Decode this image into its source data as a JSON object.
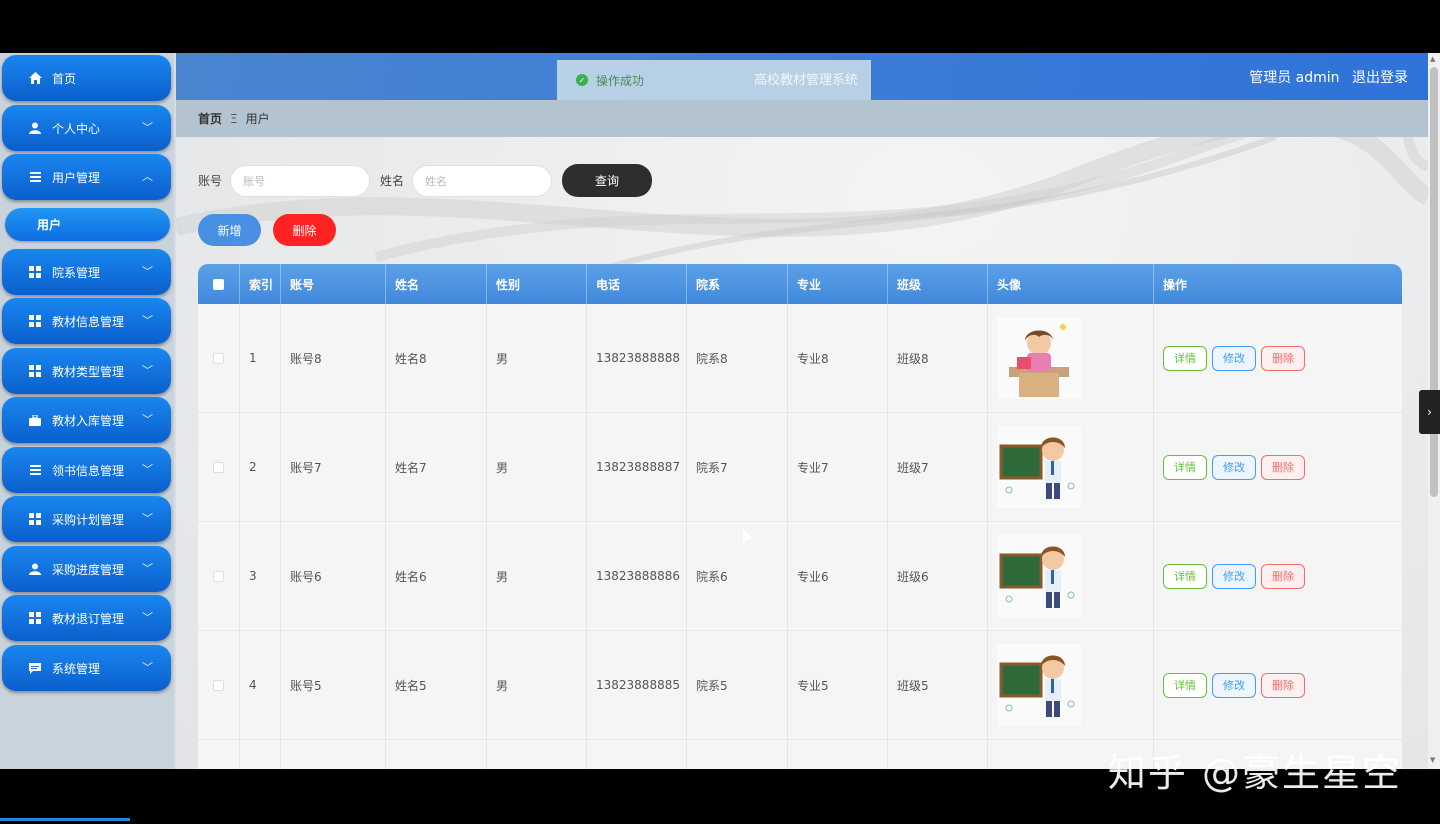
{
  "sidebar": {
    "items": [
      {
        "label": "首页",
        "icon": "home-icon",
        "has_chevron": false
      },
      {
        "label": "个人中心",
        "icon": "user-icon",
        "has_chevron": true
      },
      {
        "label": "用户管理",
        "icon": "list-icon",
        "has_chevron": true,
        "expanded": true
      },
      {
        "label": "院系管理",
        "icon": "grid-icon",
        "has_chevron": true
      },
      {
        "label": "教材信息管理",
        "icon": "grid-icon",
        "has_chevron": true
      },
      {
        "label": "教材类型管理",
        "icon": "grid-icon",
        "has_chevron": true
      },
      {
        "label": "教材入库管理",
        "icon": "briefcase-icon",
        "has_chevron": true
      },
      {
        "label": "领书信息管理",
        "icon": "list-icon",
        "has_chevron": true
      },
      {
        "label": "采购计划管理",
        "icon": "grid-icon",
        "has_chevron": true
      },
      {
        "label": "采购进度管理",
        "icon": "user-icon",
        "has_chevron": true
      },
      {
        "label": "教材退订管理",
        "icon": "grid-icon",
        "has_chevron": true
      },
      {
        "label": "系统管理",
        "icon": "chat-icon",
        "has_chevron": true
      }
    ],
    "sub_item": "用户"
  },
  "header": {
    "toast_message": "操作成功",
    "system_title": "高校教材管理系统",
    "user_label": "管理员 admin",
    "logout": "退出登录"
  },
  "breadcrumb": {
    "home": "首页",
    "separator": "Ξ",
    "current": "用户"
  },
  "search": {
    "account_label": "账号",
    "account_placeholder": "账号",
    "name_label": "姓名",
    "name_placeholder": "姓名",
    "query_button": "查询"
  },
  "actions": {
    "add": "新增",
    "delete": "删除"
  },
  "table": {
    "headers": [
      "索引",
      "账号",
      "姓名",
      "性别",
      "电话",
      "院系",
      "专业",
      "班级",
      "头像",
      "操作"
    ],
    "op_labels": {
      "detail": "详情",
      "edit": "修改",
      "delete": "删除"
    },
    "rows": [
      {
        "index": "1",
        "account": "账号8",
        "name": "姓名8",
        "gender": "男",
        "phone": "13823888888",
        "dept": "院系8",
        "major": "专业8",
        "class": "班级8",
        "avatar": "teacher-reading"
      },
      {
        "index": "2",
        "account": "账号7",
        "name": "姓名7",
        "gender": "男",
        "phone": "13823888887",
        "dept": "院系7",
        "major": "专业7",
        "class": "班级7",
        "avatar": "teacher-blackboard"
      },
      {
        "index": "3",
        "account": "账号6",
        "name": "姓名6",
        "gender": "男",
        "phone": "13823888886",
        "dept": "院系6",
        "major": "专业6",
        "class": "班级6",
        "avatar": "teacher-blackboard"
      },
      {
        "index": "4",
        "account": "账号5",
        "name": "姓名5",
        "gender": "男",
        "phone": "13823888885",
        "dept": "院系5",
        "major": "专业5",
        "class": "班级5",
        "avatar": "teacher-blackboard"
      }
    ]
  },
  "watermark": "知乎 @豪生星空",
  "colors": {
    "accent": "#1a86f0",
    "header": "#3f7fd6",
    "danger": "#ff2222",
    "success": "#67c23a"
  }
}
